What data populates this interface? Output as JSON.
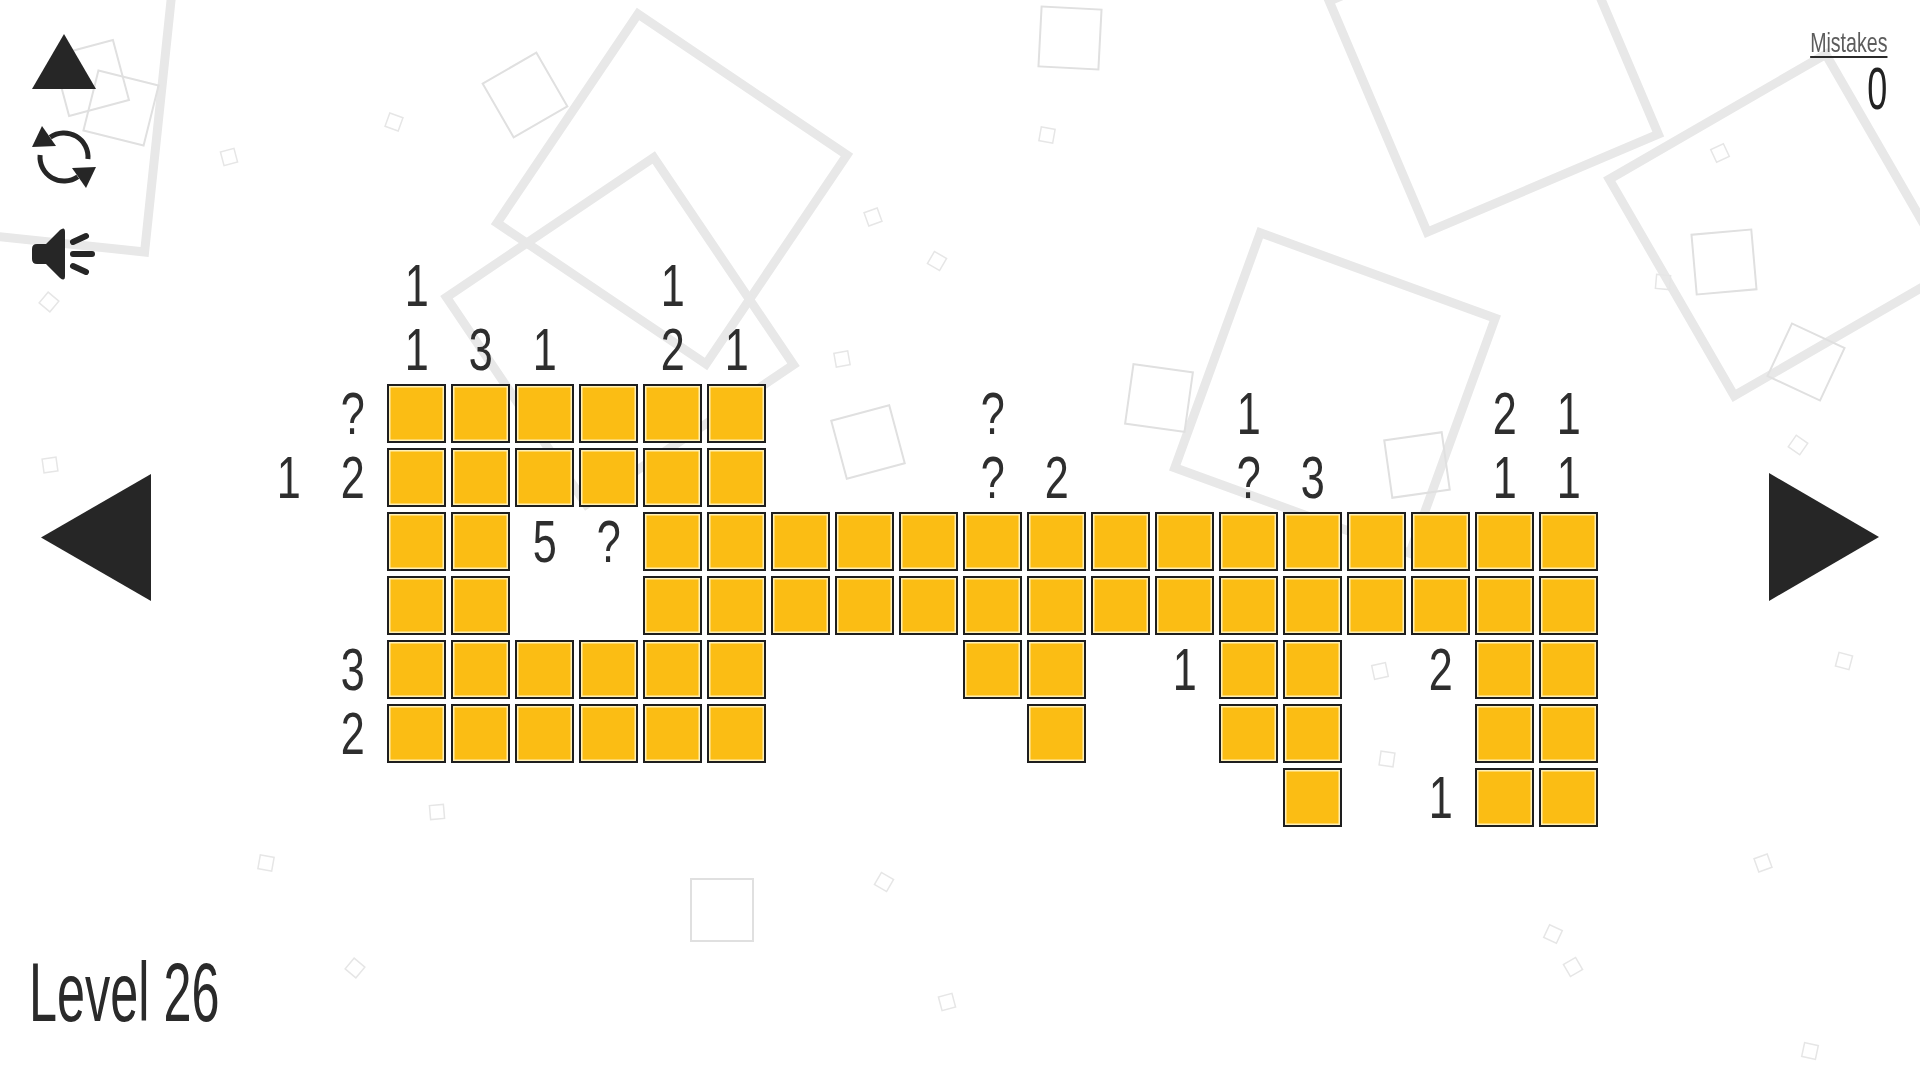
{
  "level_label": "Level 26",
  "mistakes": {
    "label": "Mistakes",
    "count": "0"
  },
  "board": {
    "rows": [
      {
        "cells": [
          {
            "kind": "blank"
          },
          {
            "kind": "blank"
          },
          {
            "kind": "clue",
            "text": "1"
          },
          {
            "kind": "blank"
          },
          {
            "kind": "blank"
          },
          {
            "kind": "blank"
          },
          {
            "kind": "clue",
            "text": "1"
          },
          {
            "kind": "blank"
          },
          {
            "kind": "blank"
          },
          {
            "kind": "blank"
          },
          {
            "kind": "blank"
          },
          {
            "kind": "blank"
          },
          {
            "kind": "blank"
          },
          {
            "kind": "blank"
          },
          {
            "kind": "blank"
          },
          {
            "kind": "blank"
          },
          {
            "kind": "blank"
          },
          {
            "kind": "blank"
          },
          {
            "kind": "blank"
          },
          {
            "kind": "blank"
          },
          {
            "kind": "blank"
          }
        ]
      },
      {
        "cells": [
          {
            "kind": "blank"
          },
          {
            "kind": "blank"
          },
          {
            "kind": "clue",
            "text": "1"
          },
          {
            "kind": "clue",
            "text": "3"
          },
          {
            "kind": "clue",
            "text": "1"
          },
          {
            "kind": "blank"
          },
          {
            "kind": "clue",
            "text": "2"
          },
          {
            "kind": "clue",
            "text": "1"
          },
          {
            "kind": "blank"
          },
          {
            "kind": "blank"
          },
          {
            "kind": "blank"
          },
          {
            "kind": "blank"
          },
          {
            "kind": "blank"
          },
          {
            "kind": "blank"
          },
          {
            "kind": "blank"
          },
          {
            "kind": "blank"
          },
          {
            "kind": "blank"
          },
          {
            "kind": "blank"
          },
          {
            "kind": "blank"
          },
          {
            "kind": "blank"
          },
          {
            "kind": "blank"
          }
        ]
      },
      {
        "cells": [
          {
            "kind": "blank"
          },
          {
            "kind": "clue",
            "text": "?"
          },
          {
            "kind": "tile"
          },
          {
            "kind": "tile"
          },
          {
            "kind": "tile"
          },
          {
            "kind": "tile"
          },
          {
            "kind": "tile"
          },
          {
            "kind": "tile"
          },
          {
            "kind": "blank"
          },
          {
            "kind": "blank"
          },
          {
            "kind": "blank"
          },
          {
            "kind": "clue",
            "text": "?"
          },
          {
            "kind": "blank"
          },
          {
            "kind": "blank"
          },
          {
            "kind": "blank"
          },
          {
            "kind": "clue",
            "text": "1"
          },
          {
            "kind": "blank"
          },
          {
            "kind": "blank"
          },
          {
            "kind": "blank"
          },
          {
            "kind": "clue",
            "text": "2"
          },
          {
            "kind": "clue",
            "text": "1"
          }
        ]
      },
      {
        "cells": [
          {
            "kind": "clue",
            "text": "1"
          },
          {
            "kind": "clue",
            "text": "2"
          },
          {
            "kind": "tile"
          },
          {
            "kind": "tile"
          },
          {
            "kind": "tile"
          },
          {
            "kind": "tile"
          },
          {
            "kind": "tile"
          },
          {
            "kind": "tile"
          },
          {
            "kind": "blank"
          },
          {
            "kind": "blank"
          },
          {
            "kind": "blank"
          },
          {
            "kind": "clue",
            "text": "?"
          },
          {
            "kind": "clue",
            "text": "2"
          },
          {
            "kind": "blank"
          },
          {
            "kind": "blank"
          },
          {
            "kind": "clue",
            "text": "?"
          },
          {
            "kind": "clue",
            "text": "3"
          },
          {
            "kind": "blank"
          },
          {
            "kind": "blank"
          },
          {
            "kind": "clue",
            "text": "1"
          },
          {
            "kind": "clue",
            "text": "1"
          }
        ]
      },
      {
        "cells": [
          {
            "kind": "blank"
          },
          {
            "kind": "blank"
          },
          {
            "kind": "tile"
          },
          {
            "kind": "tile"
          },
          {
            "kind": "clue",
            "text": "5"
          },
          {
            "kind": "clue",
            "text": "?"
          },
          {
            "kind": "tile"
          },
          {
            "kind": "tile"
          },
          {
            "kind": "tile"
          },
          {
            "kind": "tile"
          },
          {
            "kind": "tile"
          },
          {
            "kind": "tile"
          },
          {
            "kind": "tile"
          },
          {
            "kind": "tile"
          },
          {
            "kind": "tile"
          },
          {
            "kind": "tile"
          },
          {
            "kind": "tile"
          },
          {
            "kind": "tile"
          },
          {
            "kind": "tile"
          },
          {
            "kind": "tile"
          },
          {
            "kind": "tile"
          }
        ]
      },
      {
        "cells": [
          {
            "kind": "blank"
          },
          {
            "kind": "blank"
          },
          {
            "kind": "tile"
          },
          {
            "kind": "tile"
          },
          {
            "kind": "blank"
          },
          {
            "kind": "blank"
          },
          {
            "kind": "tile"
          },
          {
            "kind": "tile"
          },
          {
            "kind": "tile"
          },
          {
            "kind": "tile"
          },
          {
            "kind": "tile"
          },
          {
            "kind": "tile"
          },
          {
            "kind": "tile"
          },
          {
            "kind": "tile"
          },
          {
            "kind": "tile"
          },
          {
            "kind": "tile"
          },
          {
            "kind": "tile"
          },
          {
            "kind": "tile"
          },
          {
            "kind": "tile"
          },
          {
            "kind": "tile"
          },
          {
            "kind": "tile"
          }
        ]
      },
      {
        "cells": [
          {
            "kind": "blank"
          },
          {
            "kind": "clue",
            "text": "3"
          },
          {
            "kind": "tile"
          },
          {
            "kind": "tile"
          },
          {
            "kind": "tile"
          },
          {
            "kind": "tile"
          },
          {
            "kind": "tile"
          },
          {
            "kind": "tile"
          },
          {
            "kind": "blank"
          },
          {
            "kind": "blank"
          },
          {
            "kind": "blank"
          },
          {
            "kind": "tile"
          },
          {
            "kind": "tile"
          },
          {
            "kind": "blank"
          },
          {
            "kind": "clue",
            "text": "1"
          },
          {
            "kind": "tile"
          },
          {
            "kind": "tile"
          },
          {
            "kind": "blank"
          },
          {
            "kind": "clue",
            "text": "2"
          },
          {
            "kind": "tile"
          },
          {
            "kind": "tile"
          }
        ]
      },
      {
        "cells": [
          {
            "kind": "blank"
          },
          {
            "kind": "clue",
            "text": "2"
          },
          {
            "kind": "tile"
          },
          {
            "kind": "tile"
          },
          {
            "kind": "tile"
          },
          {
            "kind": "tile"
          },
          {
            "kind": "tile"
          },
          {
            "kind": "tile"
          },
          {
            "kind": "blank"
          },
          {
            "kind": "blank"
          },
          {
            "kind": "blank"
          },
          {
            "kind": "blank"
          },
          {
            "kind": "tile"
          },
          {
            "kind": "blank"
          },
          {
            "kind": "blank"
          },
          {
            "kind": "tile"
          },
          {
            "kind": "tile"
          },
          {
            "kind": "blank"
          },
          {
            "kind": "blank"
          },
          {
            "kind": "tile"
          },
          {
            "kind": "tile"
          }
        ]
      },
      {
        "cells": [
          {
            "kind": "blank"
          },
          {
            "kind": "blank"
          },
          {
            "kind": "blank"
          },
          {
            "kind": "blank"
          },
          {
            "kind": "blank"
          },
          {
            "kind": "blank"
          },
          {
            "kind": "blank"
          },
          {
            "kind": "blank"
          },
          {
            "kind": "blank"
          },
          {
            "kind": "blank"
          },
          {
            "kind": "blank"
          },
          {
            "kind": "blank"
          },
          {
            "kind": "blank"
          },
          {
            "kind": "blank"
          },
          {
            "kind": "blank"
          },
          {
            "kind": "blank"
          },
          {
            "kind": "tile"
          },
          {
            "kind": "blank"
          },
          {
            "kind": "clue",
            "text": "1"
          },
          {
            "kind": "tile"
          },
          {
            "kind": "tile"
          }
        ]
      }
    ]
  }
}
